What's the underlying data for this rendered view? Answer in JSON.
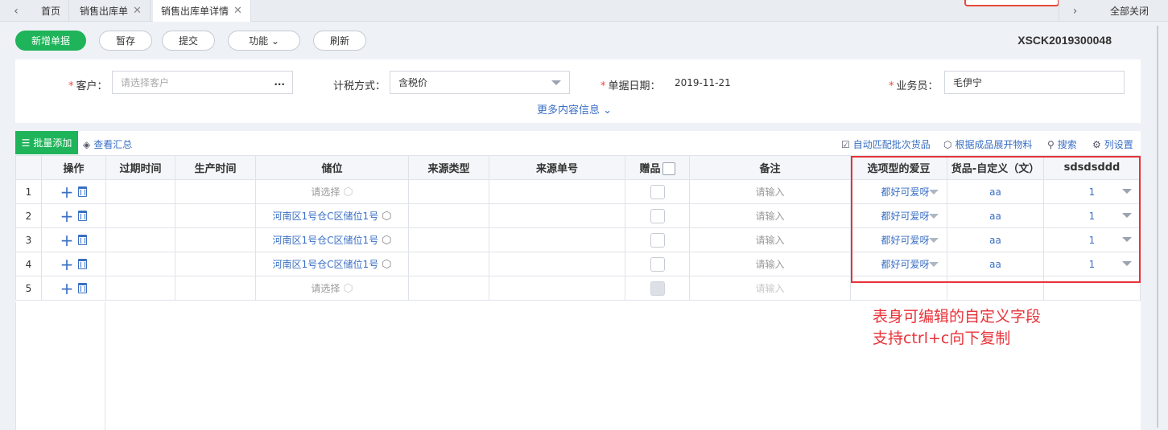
{
  "tabs": {
    "prev_arrow": "‹",
    "next_arrow": "›",
    "items": [
      {
        "label": "首页"
      },
      {
        "label": "销售出库单",
        "close": "✕"
      },
      {
        "label": "销售出库单详情",
        "close": "✕"
      }
    ],
    "close_all": "全部关闭"
  },
  "toolbar": {
    "new": "新增单据",
    "save_draft": "暂存",
    "submit": "提交",
    "functions": "功能 ⌄",
    "refresh": "刷新",
    "doc_number": "XSCK2019300048"
  },
  "header": {
    "customer_label": "客户：",
    "customer_placeholder": "请选择客户",
    "customer_more": "...",
    "tax_label": "计税方式：",
    "tax_value": "含税价",
    "date_label": "单据日期：",
    "date_value": "2019-11-21",
    "salesman_label": "业务员：",
    "salesman_value": "毛伊宁",
    "required_mark": "*",
    "more_info": "更多内容信息 ⌄"
  },
  "grid_toolbar": {
    "batch_add": "批量添加",
    "view_summary": "查看汇总",
    "auto_match": "自动匹配批次货品",
    "expand_materials": "根据成品展开物料",
    "search": "搜索",
    "column_settings": "列设置"
  },
  "columns": [
    "",
    "操作",
    "过期时间",
    "生产时间",
    "储位",
    "来源类型",
    "来源单号",
    "赠品",
    "备注",
    "选项型的爱豆",
    "货品-自定义（文）",
    "sdsdsddd"
  ],
  "rows": [
    {
      "num": "1",
      "location": "请选择",
      "location_placeholder": true,
      "note": "请输入",
      "idol": "都好可爱呀",
      "custom_text": "aa",
      "sds": "1"
    },
    {
      "num": "2",
      "location": "河南区1号仓C区储位1号",
      "location_placeholder": false,
      "note": "请输入",
      "idol": "都好可爱呀",
      "custom_text": "aa",
      "sds": "1"
    },
    {
      "num": "3",
      "location": "河南区1号仓C区储位1号",
      "location_placeholder": false,
      "note": "请输入",
      "idol": "都好可爱呀",
      "custom_text": "aa",
      "sds": "1"
    },
    {
      "num": "4",
      "location": "河南区1号仓C区储位1号",
      "location_placeholder": false,
      "note": "请输入",
      "idol": "都好可爱呀",
      "custom_text": "aa",
      "sds": "1"
    },
    {
      "num": "5",
      "location": "请选择",
      "location_placeholder": true,
      "note": "请输入",
      "idol": "",
      "custom_text": "",
      "sds": ""
    }
  ],
  "annotation": {
    "line1": "表身可编辑的自定义字段",
    "line2": "支持ctrl+c向下复制"
  },
  "colors": {
    "primary_green": "#1fb45a",
    "link_blue": "#3a6fc4",
    "highlight_red": "#e8333a"
  }
}
